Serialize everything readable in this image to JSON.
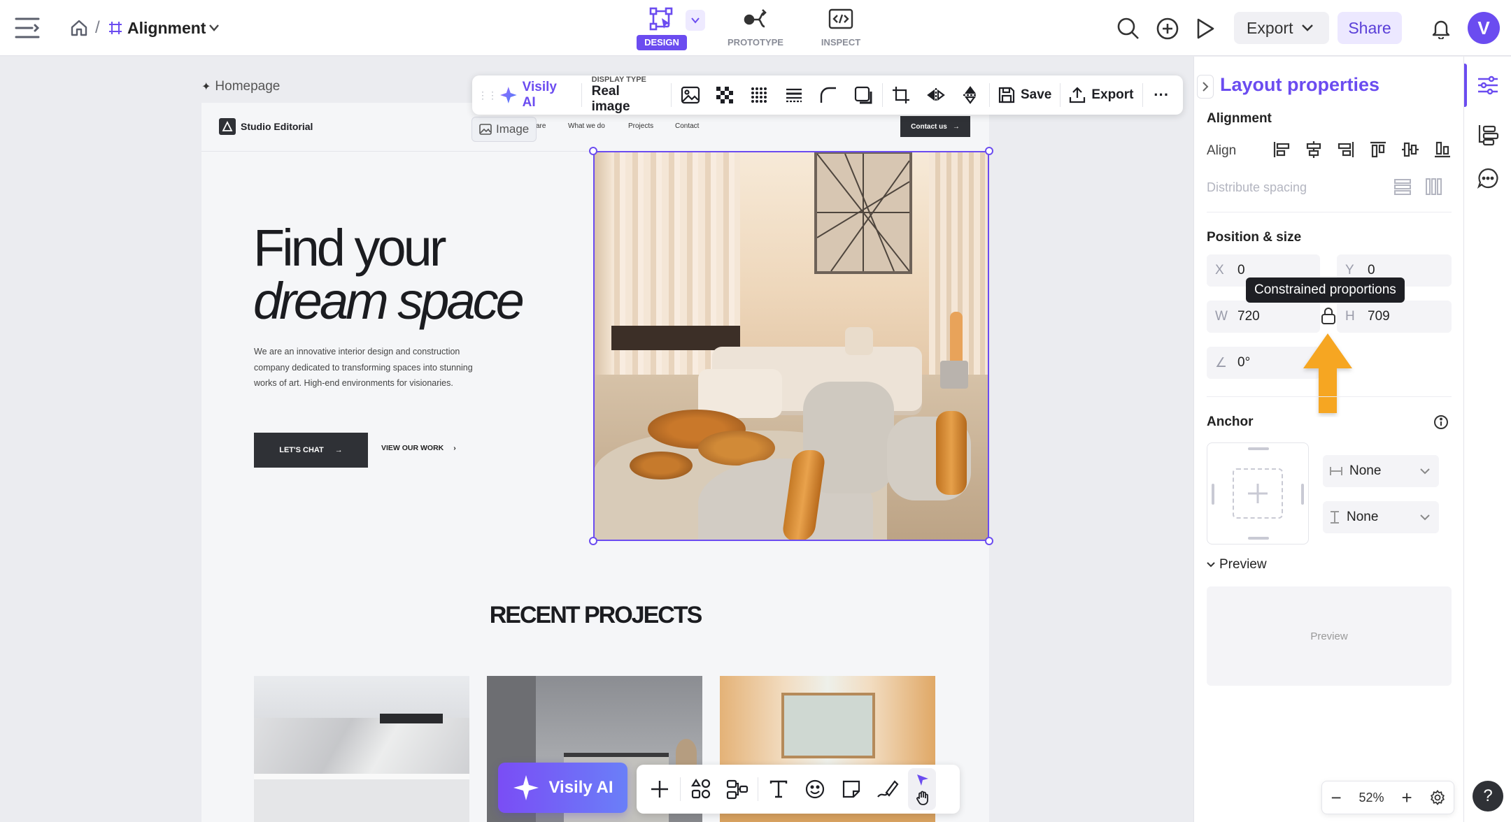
{
  "topbar": {
    "breadcrumb_sep": "/",
    "file_name": "Alignment",
    "modes": [
      {
        "label": "DESIGN",
        "active": true
      },
      {
        "label": "PROTOTYPE",
        "active": false
      },
      {
        "label": "INSPECT",
        "active": false
      }
    ],
    "export_label": "Export",
    "share_label": "Share",
    "avatar_letter": "V"
  },
  "canvas": {
    "frame_label": "Homepage",
    "element_tag": "Image",
    "toolbar": {
      "ai_label": "Visily AI",
      "display_type_caption": "DISPLAY TYPE",
      "display_type_value": "Real image",
      "save_label": "Save",
      "export_label": "Export",
      "more_label": "···"
    },
    "page": {
      "brand": "Studio Editorial",
      "nav": [
        "are",
        "What we do",
        "Projects",
        "Contact"
      ],
      "contact_btn": "Contact us",
      "hero_line1": "Find your",
      "hero_line2": "dream space",
      "hero_body": "We are an innovative interior design and construction company dedicated to transforming spaces into stunning works of art. High-end environments for visionaries.",
      "cta_primary": "LET'S CHAT",
      "cta_secondary": "VIEW OUR WORK",
      "section_title": "RECENT PROJECTS"
    }
  },
  "bottom_toolbar": {
    "ai_label": "Visily AI"
  },
  "panel": {
    "title": "Layout properties",
    "alignment_title": "Alignment",
    "align_label": "Align",
    "distribute_label": "Distribute spacing",
    "position_title": "Position & size",
    "x_label": "X",
    "x_value": "0",
    "y_label": "Y",
    "y_value": "0",
    "w_label": "W",
    "w_value": "720",
    "h_label": "H",
    "h_value": "709",
    "rotation_value": "0°",
    "tooltip": "Constrained proportions",
    "anchor_title": "Anchor",
    "anchor_h": "None",
    "anchor_v": "None",
    "preview_title": "Preview",
    "preview_placeholder": "Preview"
  },
  "zoom": {
    "value": "52%",
    "minus": "−",
    "plus": "+"
  },
  "help_label": "?",
  "colors": {
    "accent": "#6b4cf0",
    "arrow": "#f6a623",
    "dark_button": "#2f3136"
  }
}
